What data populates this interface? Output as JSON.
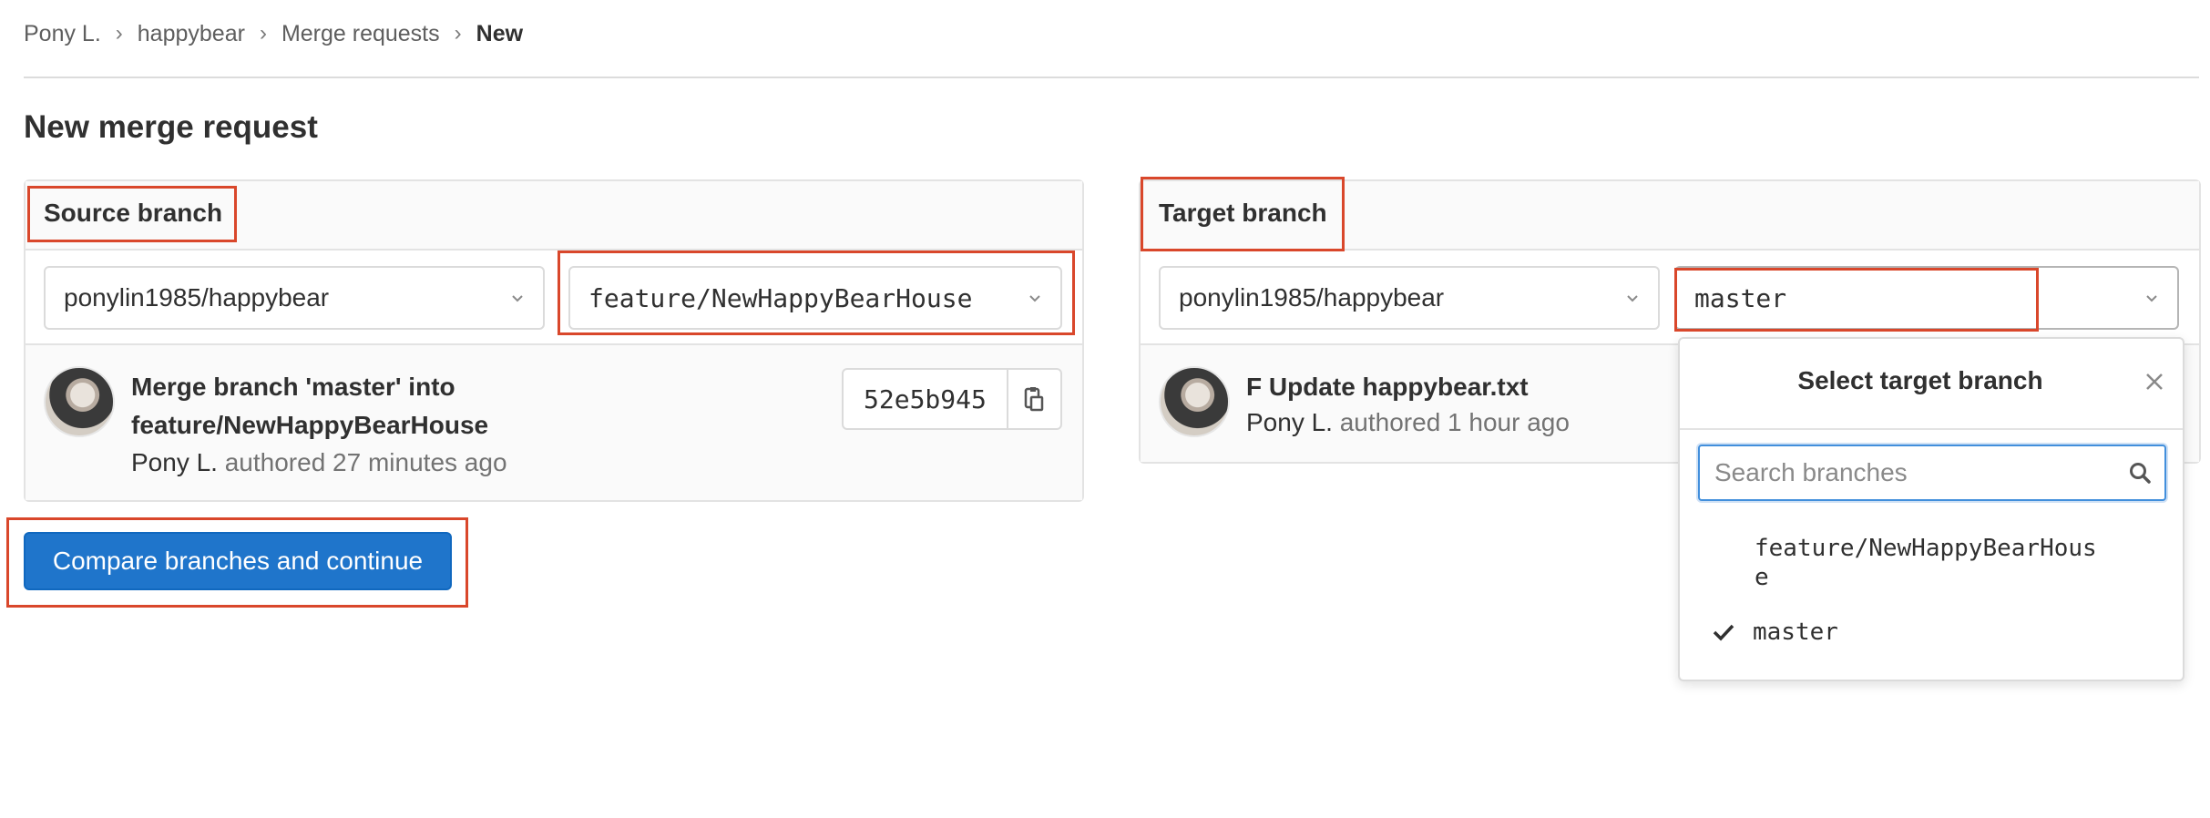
{
  "breadcrumb": {
    "items": [
      "Pony L.",
      "happybear",
      "Merge requests"
    ],
    "current": "New"
  },
  "page": {
    "title": "New merge request"
  },
  "source": {
    "heading": "Source branch",
    "project": "ponylin1985/happybear",
    "branch": "feature/NewHappyBearHouse",
    "commit": {
      "title_line1": "Merge branch 'master' into",
      "title_line2": "feature/NewHappyBearHouse",
      "author": "Pony L.",
      "meta": "authored 27 minutes ago",
      "sha": "52e5b945"
    }
  },
  "target": {
    "heading": "Target branch",
    "project": "ponylin1985/happybear",
    "branch": "master",
    "commit": {
      "title": "F Update happybear.txt",
      "author": "Pony L.",
      "meta": "authored 1 hour ago"
    }
  },
  "actions": {
    "compare_label": "Compare branches and continue"
  },
  "dropdown": {
    "title": "Select target branch",
    "search_placeholder": "Search branches",
    "options": [
      {
        "line1": "feature/NewHappyBearHous",
        "line2": "e",
        "selected": false
      },
      {
        "line1": "master",
        "selected": true
      }
    ]
  },
  "colors": {
    "accent": "#1f75cb",
    "highlight": "#d9472b",
    "text": "#303030",
    "muted": "#737373"
  },
  "icons": [
    "chevron-right-icon",
    "chevron-down-icon",
    "copy-icon",
    "close-icon",
    "search-icon",
    "check-icon"
  ]
}
